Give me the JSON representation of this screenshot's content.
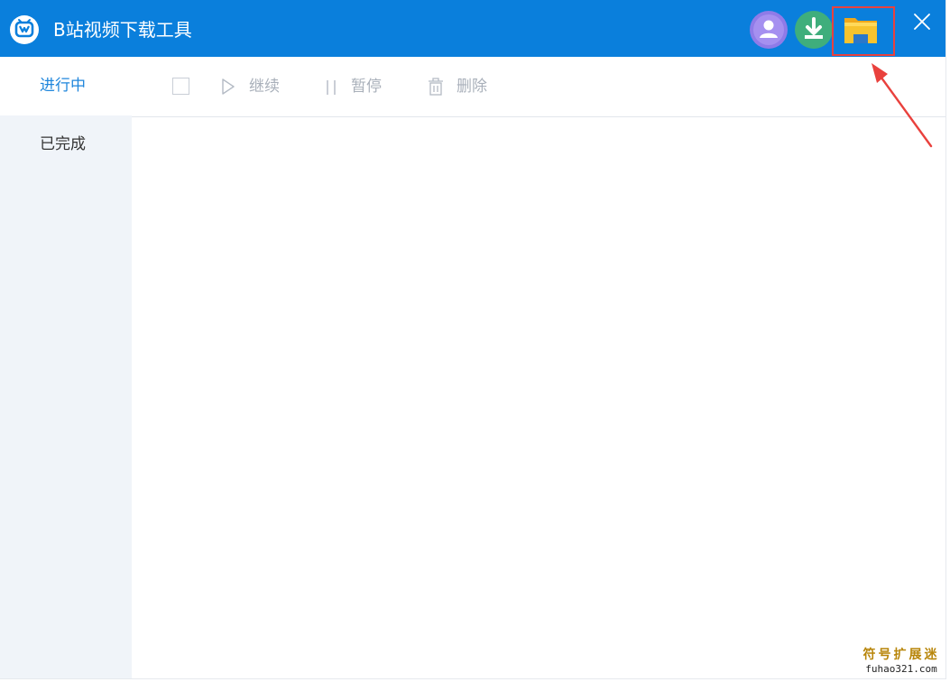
{
  "window": {
    "title": "B站视频下载工具"
  },
  "titlebar": {
    "buttons": [
      {
        "icon": "user-icon",
        "color": "#8f7be8"
      },
      {
        "icon": "download-icon",
        "color": "#3fae7c"
      },
      {
        "icon": "folder-icon",
        "color": "#f5b820"
      }
    ],
    "close_icon": "close-icon"
  },
  "sidebar": {
    "items": [
      {
        "label": "进行中",
        "active": true
      },
      {
        "label": "已完成",
        "active": false
      }
    ]
  },
  "toolbar": {
    "continue_label": "继续",
    "pause_label": "暂停",
    "delete_label": "删除"
  },
  "watermark": {
    "cn": "符号扩展迷",
    "en": "fuhao321.com"
  },
  "colors": {
    "titlebar": "#0a7fdc",
    "accent": "#1f86dc",
    "highlight": "#e9413d"
  }
}
